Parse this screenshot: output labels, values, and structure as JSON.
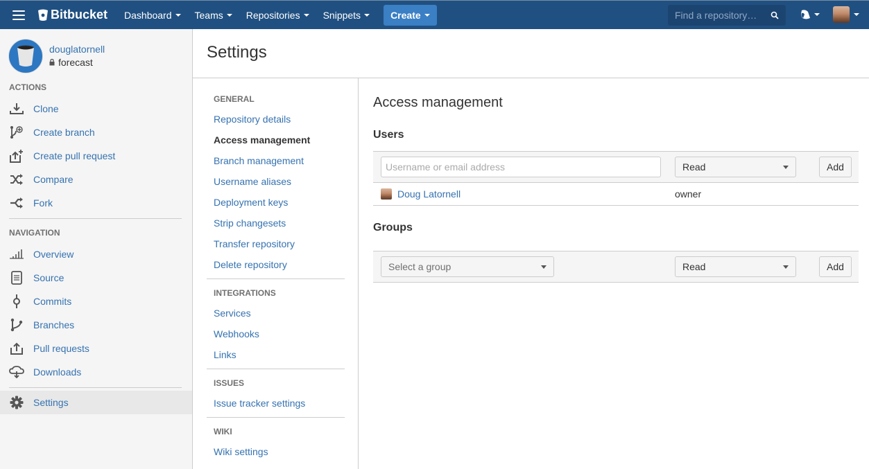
{
  "header": {
    "brand": "Bitbucket",
    "nav": [
      {
        "label": "Dashboard"
      },
      {
        "label": "Teams"
      },
      {
        "label": "Repositories"
      },
      {
        "label": "Snippets"
      }
    ],
    "create_label": "Create",
    "search_placeholder": "Find a repository…",
    "icons": {
      "menu": "hamburger-icon",
      "search": "search-icon",
      "help": "help-bubble-icon",
      "avatar": "user-avatar"
    }
  },
  "repo": {
    "owner": "douglatornell",
    "name": "forecast",
    "private": true
  },
  "sidebar": {
    "actions_title": "ACTIONS",
    "actions": [
      {
        "label": "Clone",
        "icon": "clone-icon"
      },
      {
        "label": "Create branch",
        "icon": "create-branch-icon"
      },
      {
        "label": "Create pull request",
        "icon": "create-pull-request-icon"
      },
      {
        "label": "Compare",
        "icon": "compare-icon"
      },
      {
        "label": "Fork",
        "icon": "fork-icon"
      }
    ],
    "navigation_title": "NAVIGATION",
    "navigation": [
      {
        "label": "Overview",
        "icon": "overview-icon"
      },
      {
        "label": "Source",
        "icon": "source-icon"
      },
      {
        "label": "Commits",
        "icon": "commits-icon"
      },
      {
        "label": "Branches",
        "icon": "branches-icon"
      },
      {
        "label": "Pull requests",
        "icon": "pull-requests-icon"
      },
      {
        "label": "Downloads",
        "icon": "downloads-icon"
      }
    ],
    "settings": {
      "label": "Settings",
      "icon": "gear-icon",
      "active": true
    }
  },
  "page": {
    "title": "Settings"
  },
  "settings_nav": {
    "sections": [
      {
        "title": "GENERAL",
        "links": [
          "Repository details",
          "Access management",
          "Branch management",
          "Username aliases",
          "Deployment keys",
          "Strip changesets",
          "Transfer repository",
          "Delete repository"
        ]
      },
      {
        "title": "INTEGRATIONS",
        "links": [
          "Services",
          "Webhooks",
          "Links"
        ]
      },
      {
        "title": "ISSUES",
        "links": [
          "Issue tracker settings"
        ]
      },
      {
        "title": "WIKI",
        "links": [
          "Wiki settings"
        ]
      }
    ],
    "current": "Access management"
  },
  "access": {
    "title": "Access management",
    "users": {
      "title": "Users",
      "input_placeholder": "Username or email address",
      "input_value": "",
      "permission": "Read",
      "add_label": "Add",
      "rows": [
        {
          "name": "Doug Latornell",
          "role": "owner"
        }
      ]
    },
    "groups": {
      "title": "Groups",
      "group_placeholder": "Select a group",
      "permission": "Read",
      "add_label": "Add"
    }
  }
}
